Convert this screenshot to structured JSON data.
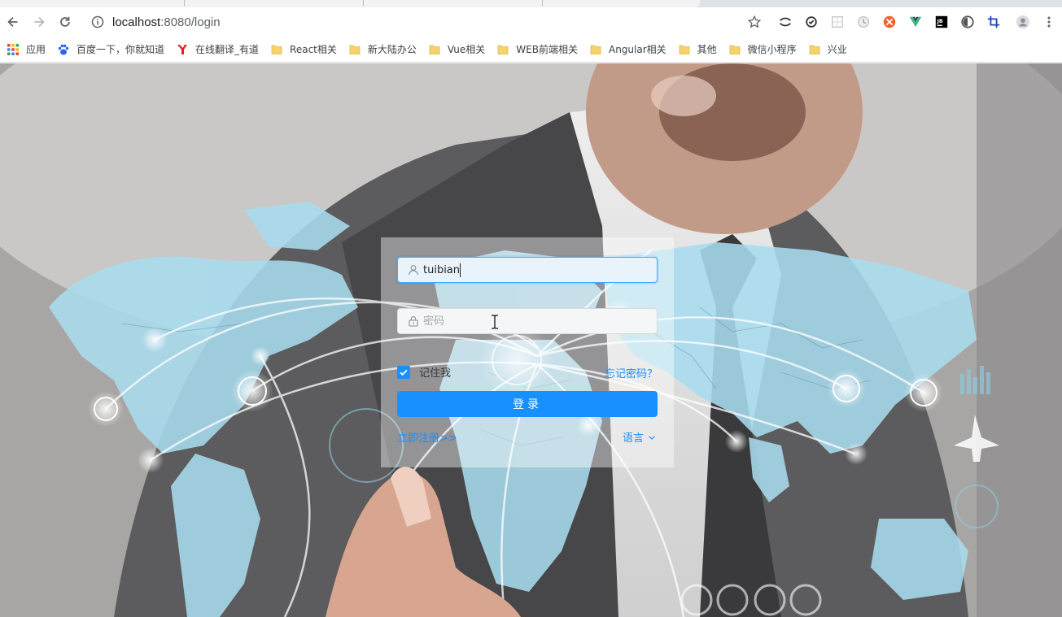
{
  "browser": {
    "url_host": "localhost",
    "url_rest": ":8080/login"
  },
  "bookmarks": [
    {
      "label": "应用",
      "icon": "apps-grid-icon"
    },
    {
      "label": "百度一下，你就知道",
      "icon": "baidu-paw-icon"
    },
    {
      "label": "在线翻译_有道",
      "icon": "youdao-icon"
    },
    {
      "label": "React相关",
      "icon": "folder-icon"
    },
    {
      "label": "新大陆办公",
      "icon": "folder-icon"
    },
    {
      "label": "Vue相关",
      "icon": "folder-icon"
    },
    {
      "label": "WEB前端相关",
      "icon": "folder-icon"
    },
    {
      "label": "Angular相关",
      "icon": "folder-icon"
    },
    {
      "label": "其他",
      "icon": "folder-icon"
    },
    {
      "label": "微信小程序",
      "icon": "folder-icon"
    },
    {
      "label": "兴业",
      "icon": "folder-icon"
    }
  ],
  "login": {
    "username_value": "tuibian",
    "password_placeholder": "密码",
    "remember_label": "记住我",
    "remember_checked": true,
    "forgot_label": "忘记密码？",
    "submit_label": "登录",
    "register_label": "立即注册>>",
    "language_label": "语言"
  },
  "colors": {
    "primary": "#1890ff",
    "folder": "#f6d26a"
  }
}
